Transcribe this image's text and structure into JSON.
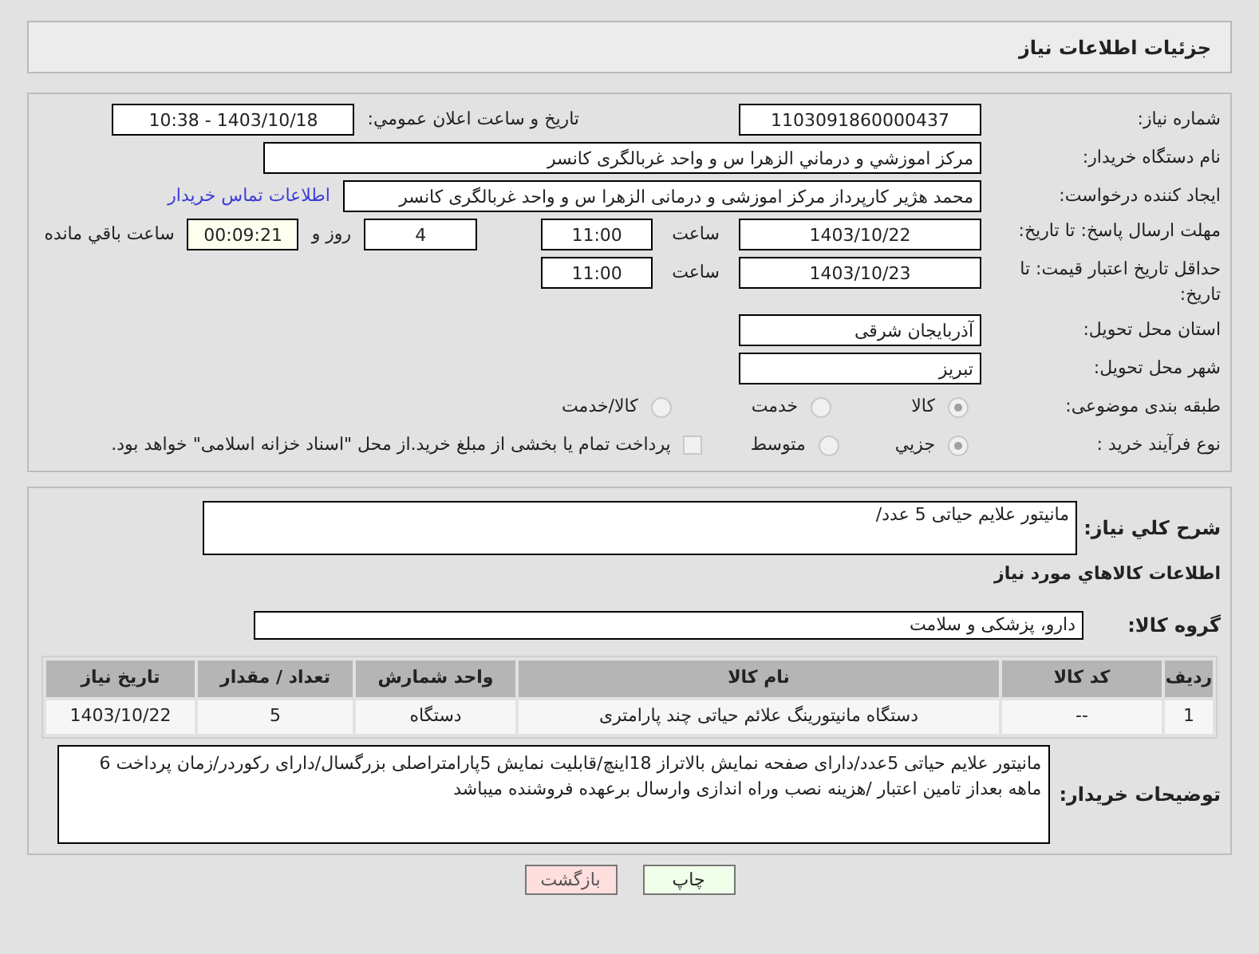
{
  "header": {
    "title": "جزئیات اطلاعات نیاز"
  },
  "need_number": {
    "label": "شماره نیاز:",
    "value": "1103091860000437"
  },
  "announce": {
    "label": "تاریخ و ساعت اعلان عمومي:",
    "value": "1403/10/18 - 10:38"
  },
  "buyer": {
    "label": "نام دستگاه خریدار:",
    "value": "مرکز اموزشي و درماني الزهرا س  و واحد غربالگری کانسر"
  },
  "requester": {
    "label": "ایجاد کننده درخواست:",
    "value": "محمد هژیر کارپرداز مرکز اموزشی و درمانی الزهرا س  و واحد غربالگری کانسر",
    "link": "اطلاعات تماس خریدار"
  },
  "reply_deadline": {
    "label": "مهلت ارسال پاسخ: تا تاریخ:",
    "date": "1403/10/22",
    "time_label": "ساعت",
    "time": "11:00",
    "days": "4",
    "days_label": "روز و",
    "remaining": "00:09:21",
    "remaining_label": "ساعت باقي مانده"
  },
  "price_validity": {
    "label": "حداقل تاریخ اعتبار قیمت: تا تاریخ:",
    "date": "1403/10/23",
    "time_label": "ساعت",
    "time": "11:00"
  },
  "province": {
    "label": "استان محل تحویل:",
    "value": "آذربایجان شرقی"
  },
  "city": {
    "label": "شهر محل تحویل:",
    "value": "تبریز"
  },
  "category": {
    "label": "طبقه بندی موضوعی:",
    "options": [
      {
        "label": "کالا",
        "selected": true
      },
      {
        "label": "خدمت",
        "selected": false
      },
      {
        "label": "کالا/خدمت",
        "selected": false
      }
    ]
  },
  "purchase_type": {
    "label": "نوع فرآیند خرید :",
    "options": [
      {
        "label": "جزیي",
        "selected": true
      },
      {
        "label": "متوسط",
        "selected": false
      }
    ],
    "payment": {
      "label": "پرداخت تمام یا بخشی از مبلغ خرید.از محل \"اسناد خزانه اسلامی\" خواهد بود.",
      "checked": false
    }
  },
  "description": {
    "label": "شرح کلي نیاز:",
    "value": "مانیتور علایم حیاتی 5 عدد/"
  },
  "goods_heading": "اطلاعات کالاهاي مورد نیاز",
  "goods_group": {
    "label": "گروه کالا:",
    "value": "دارو، پزشکی و سلامت"
  },
  "table": {
    "columns": [
      "ردیف",
      "کد کالا",
      "نام کالا",
      "واحد شمارش",
      "تعداد / مقدار",
      "تاریخ نیاز"
    ],
    "rows": [
      [
        "1",
        "--",
        "دستگاه مانیتورینگ علائم حیاتی چند پارامتری",
        "دستگاه",
        "5",
        "1403/10/22"
      ]
    ]
  },
  "buyer_notes": {
    "label": "توضیحات خریدار:",
    "value": "مانیتور علایم حیاتی 5عدد/دارای صفحه نمایش بالاتراز 18اینچ/قابلیت نمایش 5پارامتراصلی بزرگسال/دارای رکوردر/زمان پرداخت 6 ماهه بعداز تامین اعتبار /هزینه نصب وراه اندازی وارسال برعهده فروشنده میباشد"
  },
  "buttons": [
    {
      "kind": "print",
      "label": "چاپ"
    },
    {
      "kind": "back",
      "label": "بازگشت"
    }
  ]
}
